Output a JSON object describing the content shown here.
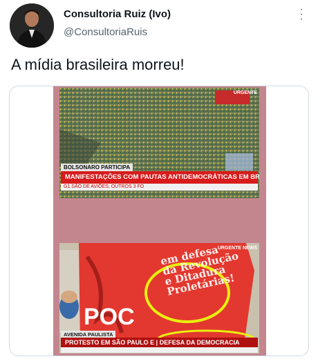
{
  "author": {
    "display_name": "Consultoria Ruiz (Ivo)",
    "handle": "@ConsultoriaRuis",
    "more_icon": "more-vertical-icon"
  },
  "tweet": {
    "text": "A mídia brasileira morreu!"
  },
  "media": {
    "top_frame": {
      "caption": "BOLSONARO PARTICIPA",
      "headline": "MANIFESTAÇÕES COM PAUTAS ANTIDEMOCRÁTICAS EM BRASÍLIA",
      "ticker": "G1 SÃO DE AVIÕES; OUTROS 3 FO",
      "badge": "URGENTE"
    },
    "bottom_frame": {
      "caption": "AVENIDA PAULISTA",
      "headline": "PROTESTO EM SÃO PAULO E | DEFESA DA DEMOCRACIA",
      "badge": "URGENTE",
      "logo": "NEWS",
      "banner": "em defesa\nda Revolução\ne Ditadura\nProletárias!",
      "banner_word": "POC"
    },
    "highlight_color": "#e8f00f"
  }
}
